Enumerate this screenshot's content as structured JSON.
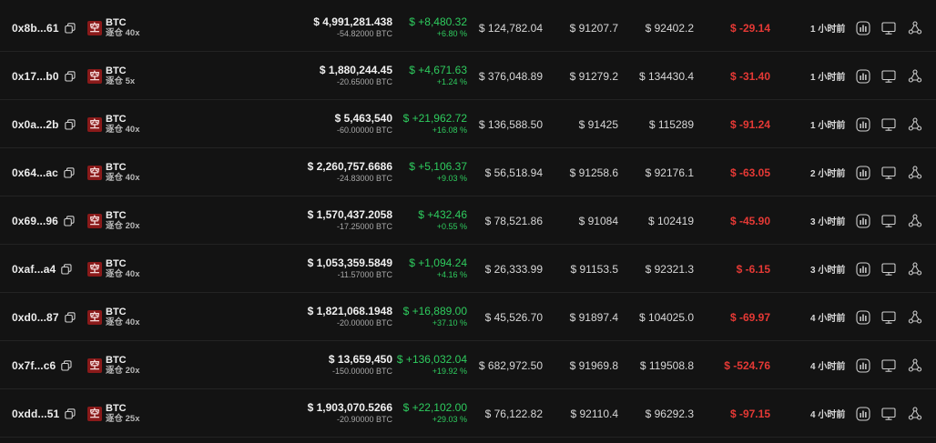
{
  "colors": {
    "background": "#131313",
    "positive": "#2ecc5e",
    "negative": "#e53935",
    "coin_badge": "#8a1a1a"
  },
  "icons": {
    "copy": "copy-icon",
    "coin": "short-badge-icon",
    "chart": "bar-chart-icon",
    "monitor": "monitor-icon",
    "share": "share-icon"
  },
  "rows": [
    {
      "address": "0x8b...61",
      "coin_badge": "空",
      "coin": "BTC",
      "leverage": "逐仓 40x",
      "value": "$ 4,991,281.438",
      "size": "-54.82000 BTC",
      "pnl": "$ +8,480.32",
      "pnl_pct": "+6.80 %",
      "margin": "$ 124,782.04",
      "entry": "$ 91207.7",
      "liq": "$ 92402.2",
      "funding": "$ -29.14",
      "time": "1 小时前"
    },
    {
      "address": "0x17...b0",
      "coin_badge": "空",
      "coin": "BTC",
      "leverage": "逐仓 5x",
      "value": "$ 1,880,244.45",
      "size": "-20.65000 BTC",
      "pnl": "$ +4,671.63",
      "pnl_pct": "+1.24 %",
      "margin": "$ 376,048.89",
      "entry": "$ 91279.2",
      "liq": "$ 134430.4",
      "funding": "$ -31.40",
      "time": "1 小时前"
    },
    {
      "address": "0x0a...2b",
      "coin_badge": "空",
      "coin": "BTC",
      "leverage": "逐仓 40x",
      "value": "$ 5,463,540",
      "size": "-60.00000 BTC",
      "pnl": "$ +21,962.72",
      "pnl_pct": "+16.08 %",
      "margin": "$ 136,588.50",
      "entry": "$ 91425",
      "liq": "$ 115289",
      "funding": "$ -91.24",
      "time": "1 小时前"
    },
    {
      "address": "0x64...ac",
      "coin_badge": "空",
      "coin": "BTC",
      "leverage": "逐仓 40x",
      "value": "$ 2,260,757.6686",
      "size": "-24.83000 BTC",
      "pnl": "$ +5,106.37",
      "pnl_pct": "+9.03 %",
      "margin": "$ 56,518.94",
      "entry": "$ 91258.6",
      "liq": "$ 92176.1",
      "funding": "$ -63.05",
      "time": "2 小时前"
    },
    {
      "address": "0x69...96",
      "coin_badge": "空",
      "coin": "BTC",
      "leverage": "逐仓 20x",
      "value": "$ 1,570,437.2058",
      "size": "-17.25000 BTC",
      "pnl": "$ +432.46",
      "pnl_pct": "+0.55 %",
      "margin": "$ 78,521.86",
      "entry": "$ 91084",
      "liq": "$ 102419",
      "funding": "$ -45.90",
      "time": "3 小时前"
    },
    {
      "address": "0xaf...a4",
      "coin_badge": "空",
      "coin": "BTC",
      "leverage": "逐仓 40x",
      "value": "$ 1,053,359.5849",
      "size": "-11.57000 BTC",
      "pnl": "$ +1,094.24",
      "pnl_pct": "+4.16 %",
      "margin": "$ 26,333.99",
      "entry": "$ 91153.5",
      "liq": "$ 92321.3",
      "funding": "$ -6.15",
      "time": "3 小时前"
    },
    {
      "address": "0xd0...87",
      "coin_badge": "空",
      "coin": "BTC",
      "leverage": "逐仓 40x",
      "value": "$ 1,821,068.1948",
      "size": "-20.00000 BTC",
      "pnl": "$ +16,889.00",
      "pnl_pct": "+37.10 %",
      "margin": "$ 45,526.70",
      "entry": "$ 91897.4",
      "liq": "$ 104025.0",
      "funding": "$ -69.97",
      "time": "4 小时前"
    },
    {
      "address": "0x7f...c6",
      "coin_badge": "空",
      "coin": "BTC",
      "leverage": "逐仓 20x",
      "value": "$ 13,659,450",
      "size": "-150.00000 BTC",
      "pnl": "$ +136,032.04",
      "pnl_pct": "+19.92 %",
      "margin": "$ 682,972.50",
      "entry": "$ 91969.8",
      "liq": "$ 119508.8",
      "funding": "$ -524.76",
      "time": "4 小时前"
    },
    {
      "address": "0xdd...51",
      "coin_badge": "空",
      "coin": "BTC",
      "leverage": "逐仓 25x",
      "value": "$ 1,903,070.5266",
      "size": "-20.90000 BTC",
      "pnl": "$ +22,102.00",
      "pnl_pct": "+29.03 %",
      "margin": "$ 76,122.82",
      "entry": "$ 92110.4",
      "liq": "$ 96292.3",
      "funding": "$ -97.15",
      "time": "4 小时前"
    }
  ]
}
